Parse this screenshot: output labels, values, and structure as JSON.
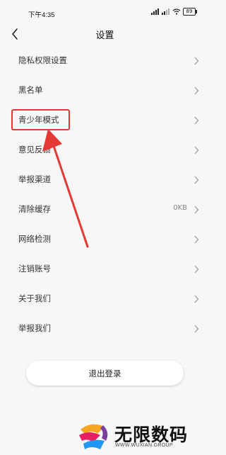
{
  "status_bar": {
    "time": "下午4:35",
    "battery": "89"
  },
  "header": {
    "title": "设置"
  },
  "settings": [
    {
      "label": "隐私权限设置",
      "value": ""
    },
    {
      "label": "黑名单",
      "value": ""
    },
    {
      "label": "青少年模式",
      "value": ""
    },
    {
      "label": "意见反馈",
      "value": ""
    },
    {
      "label": "举报渠道",
      "value": ""
    },
    {
      "label": "清除缓存",
      "value": "0KB"
    },
    {
      "label": "网络检测",
      "value": ""
    },
    {
      "label": "注销账号",
      "value": ""
    },
    {
      "label": "关于我们",
      "value": ""
    },
    {
      "label": "举报我们",
      "value": ""
    }
  ],
  "logout_label": "退出登录",
  "watermark": {
    "title": "无限数码",
    "url": "WWW.WUXIAN.GROUP"
  },
  "colors": {
    "highlight": "#e53935",
    "background": "#f7f7f7"
  }
}
